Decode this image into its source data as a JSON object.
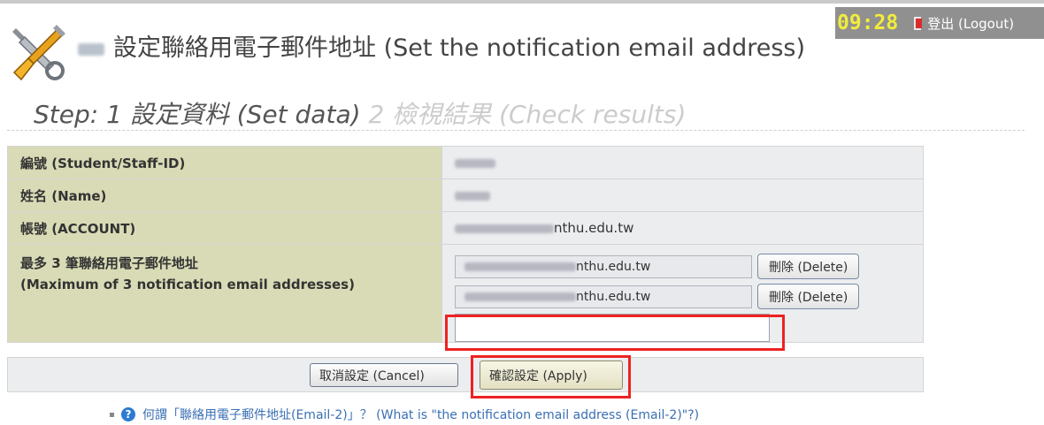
{
  "session": {
    "clock": "09:28",
    "logout_label": "登出 (Logout)"
  },
  "header": {
    "title": "設定聯絡用電子郵件地址 (Set the notification email address)"
  },
  "steps": {
    "prefix": "Step:",
    "step1_num": "1",
    "step1_label": "設定資料 (Set data)",
    "step2_num": "2",
    "step2_label": "檢視結果 (Check results)"
  },
  "form": {
    "rows": [
      {
        "label": "編號 (Student/Staff-ID)"
      },
      {
        "label": "姓名 (Name)"
      },
      {
        "label": "帳號 (ACCOUNT)",
        "value_suffix": "nthu.edu.tw"
      }
    ],
    "emails_label_line1": "最多 3 筆聯絡用電子郵件地址",
    "emails_label_line2": "(Maximum of 3 notification email addresses)",
    "emails": [
      {
        "domain": "nthu.edu.tw",
        "delete_label": "刪除 (Delete)"
      },
      {
        "domain": "nthu.edu.tw",
        "delete_label": "刪除 (Delete)"
      }
    ],
    "new_email_value": ""
  },
  "actions": {
    "cancel_label": "取消設定 (Cancel)",
    "apply_label": "確認設定 (Apply)"
  },
  "help": {
    "link_text": "何謂「聯絡用電子郵件地址(Email-2)」？ (What is \"the notification email address (Email-2)\"?)"
  },
  "colors": {
    "label_bg": "#d9dbb6",
    "value_bg": "#ecedef",
    "highlight": "#e22222",
    "link": "#3a6fb3",
    "clock": "#f2ec3c"
  }
}
